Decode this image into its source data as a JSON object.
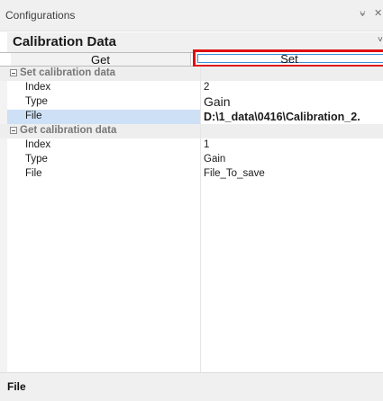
{
  "window": {
    "title": "Configurations",
    "pin_glyph": "⍱",
    "close_glyph": "✕"
  },
  "selector": {
    "value": "Calibration Data",
    "chevron": "˅"
  },
  "buttons": {
    "get": "Get",
    "set": "Set",
    "highlight_color": "#e01010"
  },
  "groups": [
    {
      "title": "Set calibration data",
      "rows": [
        {
          "label": "Index",
          "value": "2"
        },
        {
          "label": "Type",
          "value": "Gain"
        },
        {
          "label": "File",
          "value": "D:\\1_data\\0416\\Calibration_2."
        }
      ]
    },
    {
      "title": "Get calibration data",
      "rows": [
        {
          "label": "Index",
          "value": "1"
        },
        {
          "label": "Type",
          "value": "Gain"
        },
        {
          "label": "File",
          "value": "File_To_save"
        }
      ]
    }
  ],
  "status": {
    "description_title": "File"
  }
}
